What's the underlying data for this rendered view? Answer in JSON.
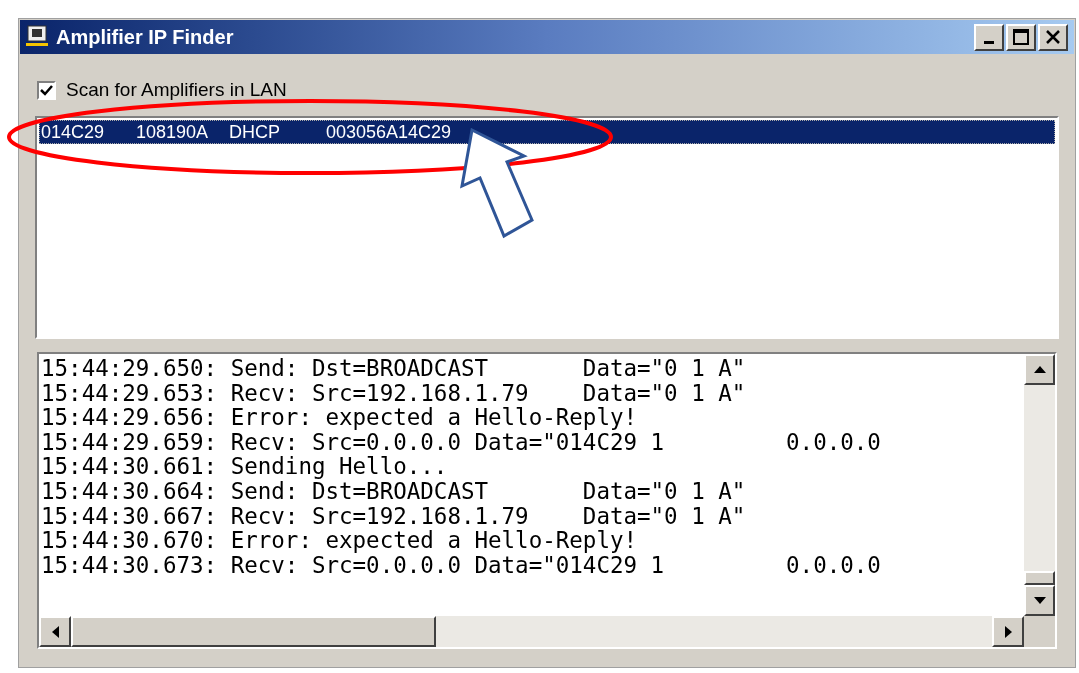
{
  "window": {
    "title": "Amplifier IP Finder"
  },
  "scan_checkbox": {
    "label": "Scan for Amplifiers in LAN",
    "checked": true
  },
  "amplifier_list": {
    "rows": [
      {
        "cells": [
          "014C29",
          "108190A",
          "DHCP",
          "003056A14C29"
        ],
        "selected": true
      }
    ]
  },
  "log": {
    "lines": [
      "15:44:29.650: Send: Dst=BROADCAST       Data=\"0 1 A\"",
      "15:44:29.653: Recv: Src=192.168.1.79    Data=\"0 1 A\"",
      "15:44:29.656: Error: expected a Hello-Reply!",
      "15:44:29.659: Recv: Src=0.0.0.0 Data=\"014C29 1         0.0.0.0",
      "15:44:30.661: Sending Hello...",
      "15:44:30.664: Send: Dst=BROADCAST       Data=\"0 1 A\"",
      "15:44:30.667: Recv: Src=192.168.1.79    Data=\"0 1 A\"",
      "15:44:30.670: Error: expected a Hello-Reply!",
      "15:44:30.673: Recv: Src=0.0.0.0 Data=\"014C29 1         0.0.0.0"
    ]
  }
}
